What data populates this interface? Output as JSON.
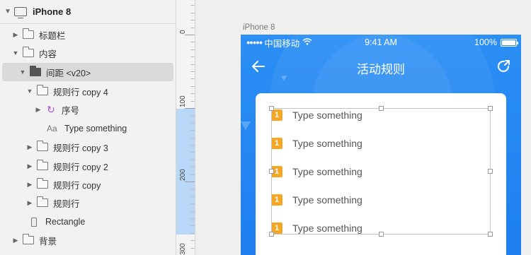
{
  "layers": {
    "artboard_title": "iPhone 8",
    "items": [
      {
        "label": "标题栏"
      },
      {
        "label": "内容"
      },
      {
        "label": "间距 <v20>"
      },
      {
        "label": "规则行 copy 4"
      },
      {
        "label": "序号"
      },
      {
        "label": "Type something",
        "type_glyph": "Aa"
      },
      {
        "label": "规则行 copy 3"
      },
      {
        "label": "规则行 copy 2"
      },
      {
        "label": "规则行 copy"
      },
      {
        "label": "规则行"
      },
      {
        "label": "Rectangle"
      },
      {
        "label": "背景"
      }
    ]
  },
  "ruler": {
    "labels": [
      "0",
      "100",
      "200",
      "300"
    ]
  },
  "artboard": {
    "name": "iPhone 8"
  },
  "phone": {
    "status": {
      "dots": "●●●●●",
      "carrier": "中国移动",
      "time": "9:41 AM",
      "battery": "100%"
    },
    "nav": {
      "title": "活动规则"
    },
    "rules": [
      {
        "number": "1",
        "text": "Type something"
      },
      {
        "number": "1",
        "text": "Type something"
      },
      {
        "number": "1",
        "text": "Type something"
      },
      {
        "number": "1",
        "text": "Type something"
      },
      {
        "number": "1",
        "text": "Type something"
      }
    ]
  },
  "colors": {
    "nav_blue": "#2b8ff5",
    "badge_orange": "#f5a623",
    "ruler_highlight": "#b9d7f7",
    "symbol_purple": "#b04ad6"
  }
}
